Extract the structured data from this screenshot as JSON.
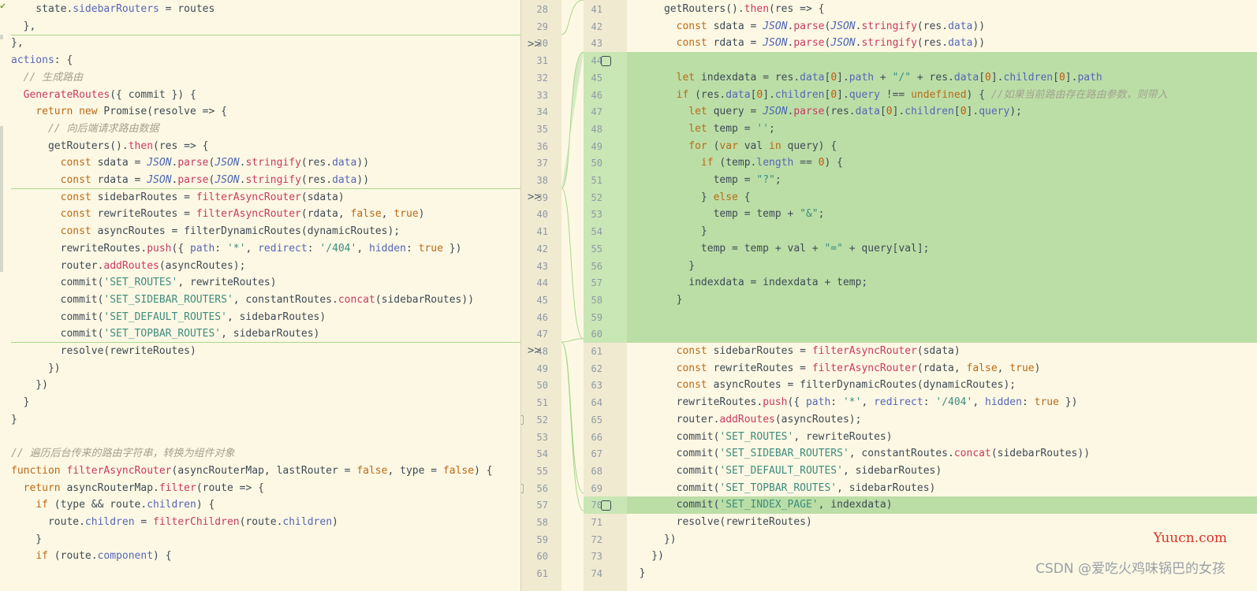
{
  "left": {
    "line_numbers": [
      "28",
      "29",
      "30",
      "31",
      "32",
      "33",
      "34",
      "35",
      "36",
      "37",
      "38",
      "39",
      "40",
      "41",
      "42",
      "43",
      "44",
      "45",
      "46",
      "47",
      "48",
      "49",
      "50",
      "51",
      "52",
      "53",
      "54",
      "55",
      "56",
      "57",
      "58",
      "59",
      "60",
      "61"
    ],
    "code": [
      "    state.sidebarRouters = routes",
      "  },",
      "},",
      "actions: {",
      "  // 生成路由",
      "  GenerateRoutes({ commit }) {",
      "    return new Promise(resolve => {",
      "      // 向后端请求路由数据",
      "      getRouters().then(res => {",
      "        const sdata = JSON.parse(JSON.stringify(res.data))",
      "        const rdata = JSON.parse(JSON.stringify(res.data))",
      "        const sidebarRoutes = filterAsyncRouter(sdata)",
      "        const rewriteRoutes = filterAsyncRouter(rdata, false, true)",
      "        const asyncRoutes = filterDynamicRoutes(dynamicRoutes);",
      "        rewriteRoutes.push({ path: '*', redirect: '/404', hidden: true })",
      "        router.addRoutes(asyncRoutes);",
      "        commit('SET_ROUTES', rewriteRoutes)",
      "        commit('SET_SIDEBAR_ROUTERS', constantRoutes.concat(sidebarRoutes))",
      "        commit('SET_DEFAULT_ROUTES', sidebarRoutes)",
      "        commit('SET_TOPBAR_ROUTES', sidebarRoutes)",
      "        resolve(rewriteRoutes)",
      "      })",
      "    })",
      "  }",
      "}",
      "",
      "// 遍历后台传来的路由字符串，转换为组件对象",
      "function filterAsyncRouter(asyncRouterMap, lastRouter = false, type = false) {",
      "  return asyncRouterMap.filter(route => {",
      "    if (type && route.children) {",
      "      route.children = filterChildren(route.children)",
      "    }",
      "    if (route.component) {",
      ""
    ]
  },
  "right": {
    "line_numbers": [
      "41",
      "42",
      "43",
      "44",
      "45",
      "46",
      "47",
      "48",
      "49",
      "50",
      "51",
      "52",
      "53",
      "54",
      "55",
      "56",
      "57",
      "58",
      "59",
      "60",
      "61",
      "62",
      "63",
      "64",
      "65",
      "66",
      "67",
      "68",
      "69",
      "70",
      "71",
      "72",
      "73",
      "74"
    ],
    "code": [
      "      getRouters().then(res => {",
      "        const sdata = JSON.parse(JSON.stringify(res.data))",
      "        const rdata = JSON.parse(JSON.stringify(res.data))",
      "",
      "        let indexdata = res.data[0].path + \"/\" + res.data[0].children[0].path",
      "        if (res.data[0].children[0].query !== undefined) { //如果当前路由存在路由参数，则带入",
      "          let query = JSON.parse(res.data[0].children[0].query);",
      "          let temp = '';",
      "          for (var val in query) {",
      "            if (temp.length == 0) {",
      "              temp = \"?\";",
      "            } else {",
      "              temp = temp + \"&\";",
      "            }",
      "            temp = temp + val + \"=\" + query[val];",
      "          }",
      "          indexdata = indexdata + temp;",
      "        }",
      "",
      "",
      "        const sidebarRoutes = filterAsyncRouter(sdata)",
      "        const rewriteRoutes = filterAsyncRouter(rdata, false, true)",
      "        const asyncRoutes = filterDynamicRoutes(dynamicRoutes);",
      "        rewriteRoutes.push({ path: '*', redirect: '/404', hidden: true })",
      "        router.addRoutes(asyncRoutes);",
      "        commit('SET_ROUTES', rewriteRoutes)",
      "        commit('SET_SIDEBAR_ROUTERS', constantRoutes.concat(sidebarRoutes))",
      "        commit('SET_DEFAULT_ROUTES', sidebarRoutes)",
      "        commit('SET_TOPBAR_ROUTES', sidebarRoutes)",
      "        commit('SET_INDEX_PAGE', indexdata)",
      "        resolve(rewriteRoutes)",
      "      })",
      "    })",
      "  }"
    ],
    "added_rows": [
      3,
      4,
      5,
      6,
      7,
      8,
      9,
      10,
      11,
      12,
      13,
      14,
      15,
      16,
      17,
      18,
      19,
      29
    ]
  },
  "merge_arrows": [
    ">>",
    ">>",
    ">>"
  ],
  "watermarks": {
    "yuucn": "Yuucn.com",
    "csdn": "CSDN @爱吃火鸡味锅巴的女孩"
  },
  "colors": {
    "background": "#fdf8e4",
    "added": "#bbdea6",
    "keyword": "#b96a18",
    "function": "#c83a62",
    "string": "#3d8c7e"
  }
}
